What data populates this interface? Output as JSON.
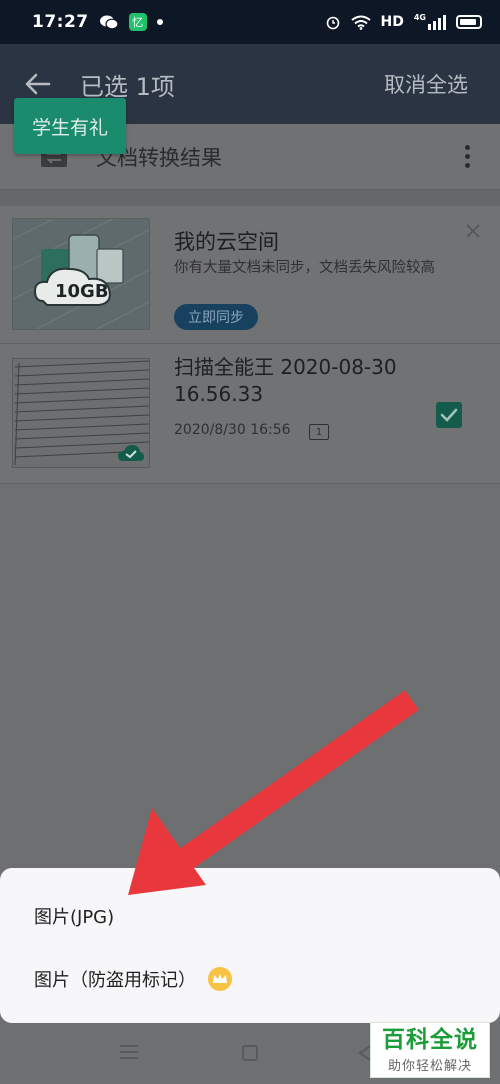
{
  "status_bar": {
    "time": "17:27",
    "wechat_icon": "wechat-icon",
    "app_icon_label": "忆",
    "network_label": "HD",
    "signal_label": "4G"
  },
  "header": {
    "title": "已选 1项",
    "deselect_all": "取消全选"
  },
  "promo_tag": "学生有礼",
  "folder": {
    "label": "文档转换结果"
  },
  "cloud_card": {
    "title": "我的云空间",
    "description": "你有大量文档未同步，文档丢失风险较高",
    "storage_label": "10GB",
    "sync_button": "立即同步"
  },
  "document": {
    "title": "扫描全能王 2020-08-30 16.56.33",
    "date": "2020/8/30 16:56",
    "pages": "1",
    "selected": true
  },
  "sheet": {
    "items": [
      {
        "label": "图片(JPG)"
      },
      {
        "label": "图片（防盗用标记）"
      }
    ]
  },
  "watermark": {
    "title": "百科全说",
    "subtitle": "助你轻松解决"
  },
  "colors": {
    "accent_green": "#1a8c6d",
    "arrow_red": "#e8383d",
    "header_bg": "#2a3442"
  }
}
